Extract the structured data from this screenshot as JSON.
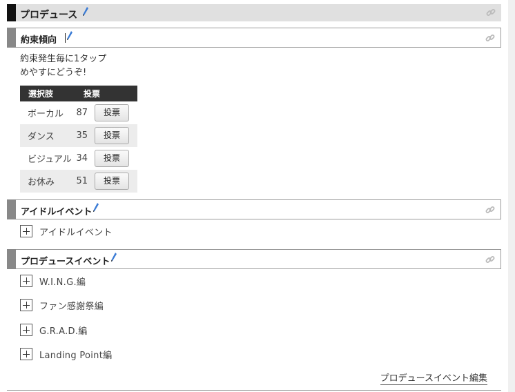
{
  "section": {
    "title": "プロデュース"
  },
  "promise": {
    "title": "約束傾向",
    "desc_line1": "約束発生毎に1タップ",
    "desc_line2": "めやすにどうぞ!",
    "table": {
      "col_option": "選択肢",
      "col_vote": "投票",
      "rows": [
        {
          "option": "ボーカル",
          "count": "87",
          "button": "投票"
        },
        {
          "option": "ダンス",
          "count": "35",
          "button": "投票"
        },
        {
          "option": "ビジュアル",
          "count": "34",
          "button": "投票"
        },
        {
          "option": "お休み",
          "count": "51",
          "button": "投票"
        }
      ]
    }
  },
  "idol_event": {
    "title": "アイドルイベント",
    "items": [
      {
        "label": "アイドルイベント"
      }
    ]
  },
  "produce_event": {
    "title": "プロデュースイベント",
    "items": [
      {
        "label": "W.I.N.G.編"
      },
      {
        "label": "ファン感謝祭編"
      },
      {
        "label": "G.R.A.D.編"
      },
      {
        "label": "Landing Point編"
      }
    ],
    "edit_link": "プロデュースイベント編集"
  },
  "colors": {
    "header_bar_dark": "#111111",
    "header_bar_gray": "#888888",
    "header_bg": "#e0e0e0",
    "table_header_bg": "#333333",
    "row_alt_bg": "#ececec",
    "pencil_blue": "#3a7bd5"
  },
  "icons": {
    "edit": "pencil-icon",
    "permalink": "link-icon",
    "expand": "plus-box-icon"
  }
}
